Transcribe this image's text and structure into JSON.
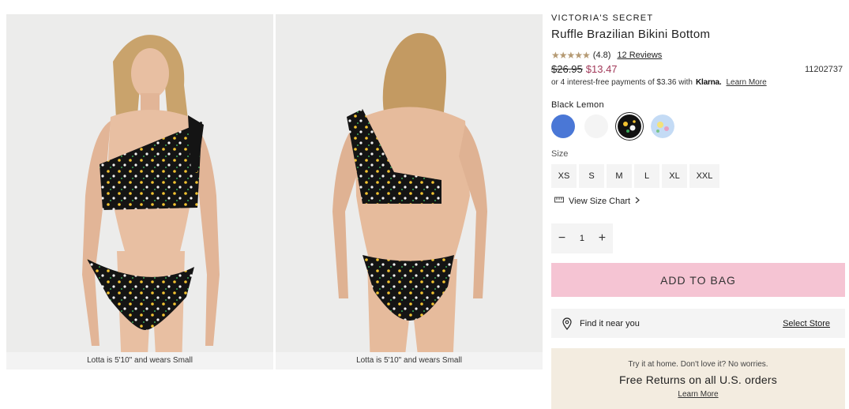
{
  "gallery": {
    "images": [
      {
        "caption": "Lotta is 5'10\" and wears Small"
      },
      {
        "caption": "Lotta is 5'10\" and wears Small"
      }
    ]
  },
  "product": {
    "brand": "VICTORIA'S SECRET",
    "title": "Ruffle Brazilian Bikini Bottom",
    "rating_stars": "★★★★★",
    "rating_value": "(4.8)",
    "reviews": "12 Reviews",
    "price_original": "$26.95",
    "price_sale": "$13.47",
    "sku": "11202737",
    "installment_text": "or 4 interest-free payments of $3.36 with",
    "installment_provider": "Klarna.",
    "installment_link": "Learn More"
  },
  "color": {
    "selected_name": "Black Lemon",
    "swatches": [
      {
        "name": "blue",
        "color": "#4a77d6"
      },
      {
        "name": "white",
        "color": "#f4f4f4"
      },
      {
        "name": "black-lemon",
        "color": "#111111",
        "selected": true
      },
      {
        "name": "light-floral",
        "color": "#c4dbf5"
      }
    ]
  },
  "size": {
    "label": "Size",
    "options": [
      "XS",
      "S",
      "M",
      "L",
      "XL",
      "XXL"
    ],
    "chart_link": "View Size Chart"
  },
  "quantity": {
    "minus": "−",
    "value": "1",
    "plus": "+"
  },
  "actions": {
    "add_to_bag": "ADD TO BAG"
  },
  "store": {
    "find_label": "Find it near you",
    "select_label": "Select Store"
  },
  "returns": {
    "line1": "Try it at home. Don't love it? No worries.",
    "line2": "Free Returns on all U.S. orders",
    "link": "Learn More"
  },
  "colors": {
    "accent_pink": "#f5c4d3",
    "sale_price": "#a23a5a",
    "star": "#b59a73",
    "returns_bg": "#f3ece0"
  }
}
